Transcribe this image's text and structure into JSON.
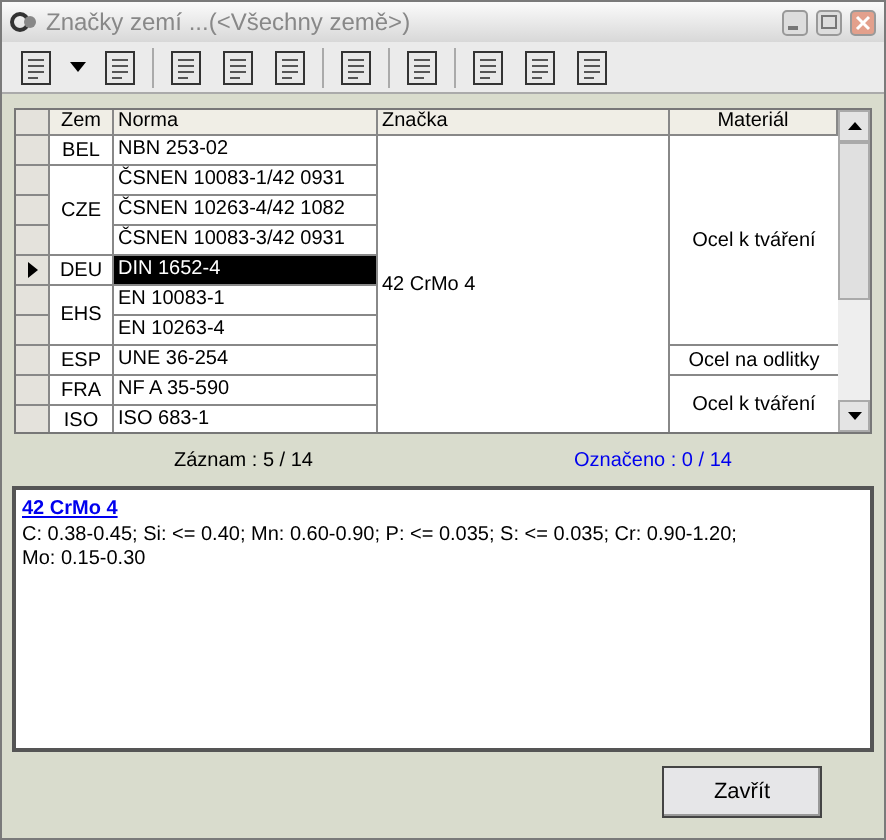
{
  "window": {
    "title": "Značky zemí ...(<Všechny země>)"
  },
  "table": {
    "columns": [
      "Zem",
      "Norma",
      "Značka",
      "Materiál"
    ],
    "znacka": "42 CrMo 4",
    "materials": [
      {
        "label": "Ocel k tváření",
        "countries": [
          {
            "code": "BEL",
            "norms": [
              {
                "text": "NBN 253-02",
                "selected": false
              }
            ]
          },
          {
            "code": "CZE",
            "norms": [
              {
                "text": "ČSNEN 10083-1/42 0931",
                "selected": false
              },
              {
                "text": "ČSNEN 10263-4/42 1082",
                "selected": false
              },
              {
                "text": "ČSNEN 10083-3/42 0931",
                "selected": false
              }
            ]
          },
          {
            "code": "DEU",
            "norms": [
              {
                "text": "DIN 1652-4",
                "selected": true
              }
            ]
          },
          {
            "code": "EHS",
            "norms": [
              {
                "text": "EN 10083-1",
                "selected": false
              },
              {
                "text": "EN 10263-4",
                "selected": false
              }
            ]
          }
        ]
      },
      {
        "label": "Ocel na odlitky",
        "countries": [
          {
            "code": "ESP",
            "norms": [
              {
                "text": "UNE 36-254",
                "selected": false
              }
            ]
          }
        ]
      },
      {
        "label": "Ocel k tváření",
        "countries": [
          {
            "code": "FRA",
            "norms": [
              {
                "text": "NF A 35-590",
                "selected": false
              }
            ]
          },
          {
            "code": "ISO",
            "norms": [
              {
                "text": "ISO 683-1",
                "selected": false
              }
            ]
          }
        ]
      }
    ]
  },
  "status": {
    "record": "Záznam : 5 / 14",
    "marked": "Označeno : 0 / 14"
  },
  "detail": {
    "title": "42 CrMo 4",
    "text": "C: 0.38-0.45; Si: <= 0.40; Mn: 0.60-0.90; P: <= 0.035; S: <= 0.035; Cr: 0.90-1.20; Mo: 0.15-0.30"
  },
  "close_button": "Zavřít"
}
